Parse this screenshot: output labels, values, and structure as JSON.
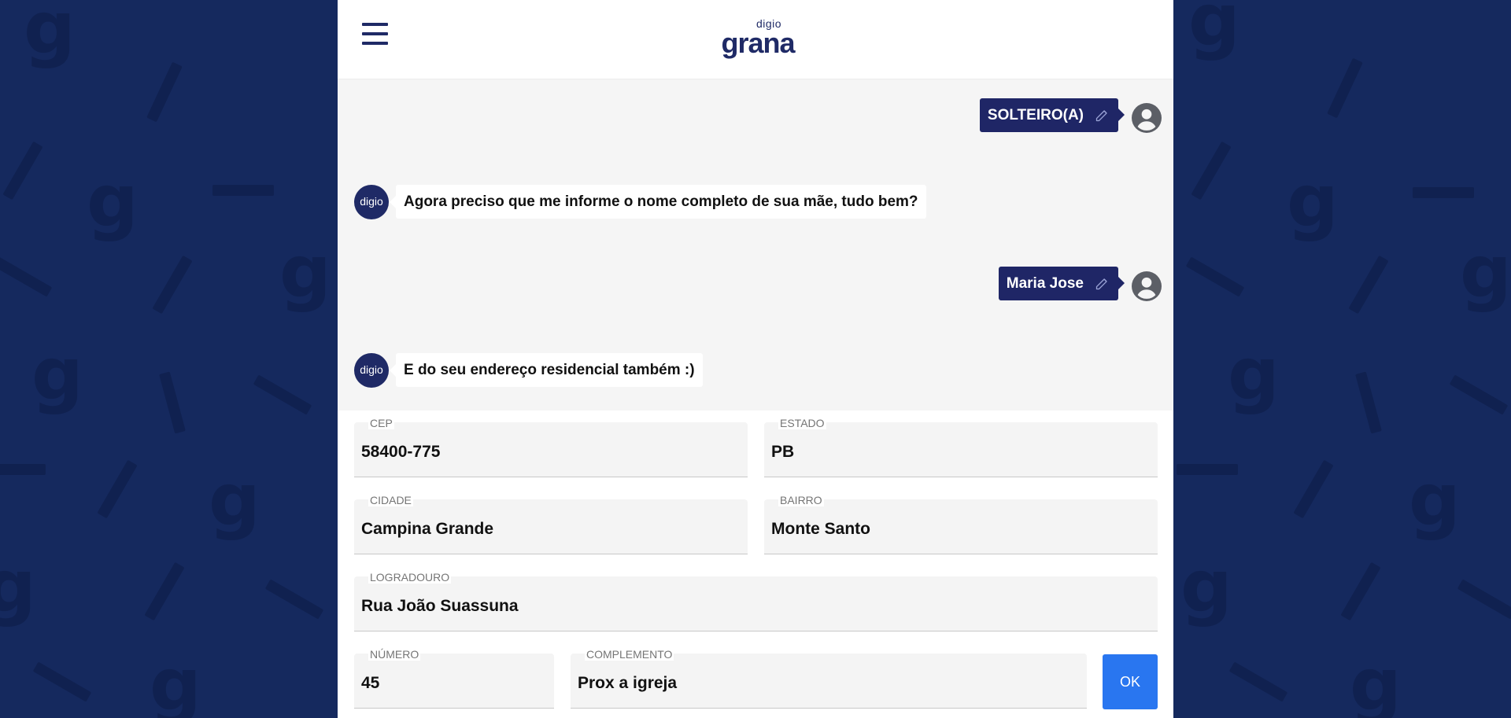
{
  "app": {
    "logo_small": "digio",
    "logo_big": "grana"
  },
  "icons": {
    "menu": "hamburger-menu-icon",
    "edit": "pencil-icon",
    "user": "account-circle-icon",
    "bot": "digio-avatar"
  },
  "colors": {
    "background": "#15295e",
    "brand_navy": "#1f2a66",
    "user_bubble": "#1f2666",
    "button": "#2976f0",
    "chat_bg": "#f5f5f5"
  },
  "chat": {
    "bot_avatar_label": "digio",
    "messages": [
      {
        "from": "user",
        "text": "SOLTEIRO(A)"
      },
      {
        "from": "bot",
        "text": "Agora preciso que me informe o nome completo de sua mãe, tudo bem?"
      },
      {
        "from": "user",
        "text": "Maria Jose"
      },
      {
        "from": "bot",
        "text": "E do seu endereço residencial também :)"
      }
    ]
  },
  "form": {
    "cep": {
      "label": "CEP",
      "value": "58400-775"
    },
    "estado": {
      "label": "ESTADO",
      "value": "PB"
    },
    "cidade": {
      "label": "CIDADE",
      "value": "Campina Grande"
    },
    "bairro": {
      "label": "BAIRRO",
      "value": "Monte Santo"
    },
    "logradouro": {
      "label": "LOGRADOURO",
      "value": "Rua João Suassuna"
    },
    "numero": {
      "label": "NÚMERO",
      "value": "45"
    },
    "complemento": {
      "label": "COMPLEMENTO",
      "value": "Prox a igreja"
    },
    "submit_label": "OK"
  }
}
